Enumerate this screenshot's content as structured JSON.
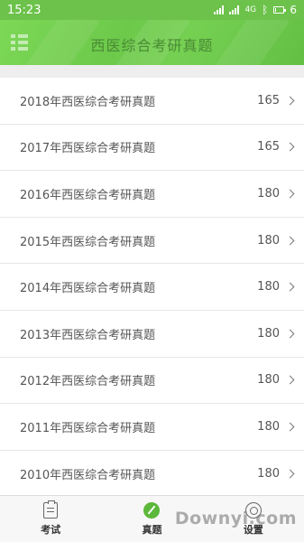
{
  "status_bar": {
    "time": "15:23",
    "net": "4G",
    "battery": "6",
    "battery_level": 0.06
  },
  "header": {
    "title": "西医综合考研真题"
  },
  "list": {
    "items": [
      {
        "label": "2018年西医综合考研真题",
        "count": "165"
      },
      {
        "label": "2017年西医综合考研真题",
        "count": "165"
      },
      {
        "label": "2016年西医综合考研真题",
        "count": "180"
      },
      {
        "label": "2015年西医综合考研真题",
        "count": "180"
      },
      {
        "label": "2014年西医综合考研真题",
        "count": "180"
      },
      {
        "label": "2013年西医综合考研真题",
        "count": "180"
      },
      {
        "label": "2012年西医综合考研真题",
        "count": "180"
      },
      {
        "label": "2011年西医综合考研真题",
        "count": "180"
      },
      {
        "label": "2010年西医综合考研真题",
        "count": "180"
      }
    ]
  },
  "tabbar": {
    "tabs": [
      {
        "label": "考试",
        "icon": "clipboard-icon"
      },
      {
        "label": "真题",
        "icon": "pencil-icon",
        "active_color": "#5cb83a"
      },
      {
        "label": "设置",
        "icon": "steering-icon"
      }
    ]
  },
  "watermark": {
    "text": "Downyi.com"
  },
  "colors": {
    "accent": "#6cc24a",
    "title": "#4a8a35"
  }
}
